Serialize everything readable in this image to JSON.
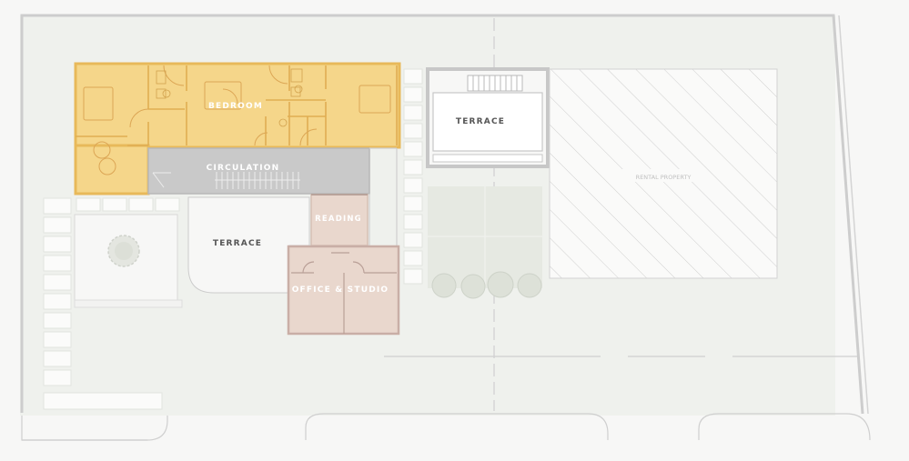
{
  "labels": {
    "bedroom": "BEDROOM",
    "circulation": "CIRCULATION",
    "reading": "READING",
    "office_studio": "OFFICE & STUDIO",
    "terrace_left": "TERRACE",
    "terrace_right": "TERRACE",
    "rental_property": "RENTAL PROPERTY"
  },
  "colors": {
    "background": "#f7f7f6",
    "site": "#eff1ed",
    "bedroom_fill": "#f5d68a",
    "bedroom_wall": "#e8b95a",
    "circulation_fill": "#c9c9c9",
    "study_fill": "#e9d7cd",
    "study_wall": "#c9aea6",
    "wall": "#c8c8c8",
    "dark_text": "#555555",
    "light_text": "#ffffff"
  }
}
